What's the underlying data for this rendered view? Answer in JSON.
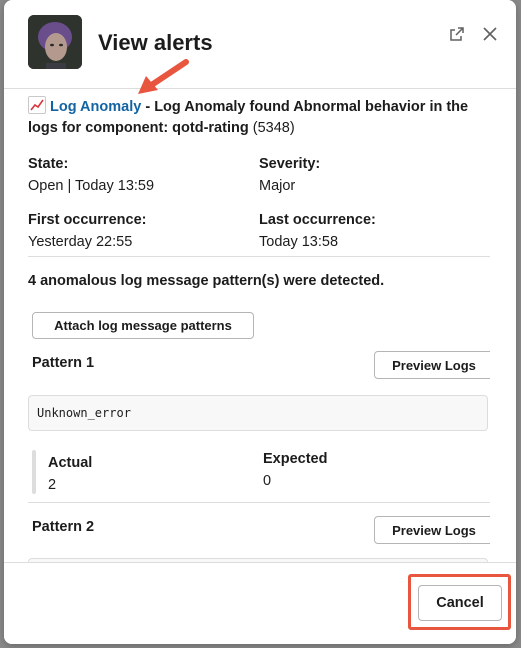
{
  "window": {
    "title": "View alerts"
  },
  "alert": {
    "emoji": "chart-increasing-icon",
    "link_label": "Log Anomaly",
    "separator": " - ",
    "description": "Log Anomaly found Abnormal behavior in the logs for component: qotd-rating",
    "count": "(5348)"
  },
  "fields": {
    "state_label": "State:",
    "state_value": "Open | Today 13:59",
    "severity_label": "Severity:",
    "severity_value": "Major",
    "first_label": "First occurrence:",
    "first_value": "Yesterday 22:55",
    "last_label": "Last occurrence:",
    "last_value": "Today 13:58"
  },
  "summary": "4 anomalous log message pattern(s) were detected.",
  "attach_button": "Attach log message patterns",
  "patterns": [
    {
      "title": "Pattern 1",
      "preview_button": "Preview Logs",
      "code": "Unknown_error",
      "actual_label": "Actual",
      "actual_value": "2",
      "expected_label": "Expected",
      "expected_value": "0"
    },
    {
      "title": "Pattern 2",
      "preview_button": "Preview Logs"
    }
  ],
  "footer": {
    "cancel_label": "Cancel"
  },
  "colors": {
    "link": "#1264a3",
    "annotation": "#e8563f"
  }
}
